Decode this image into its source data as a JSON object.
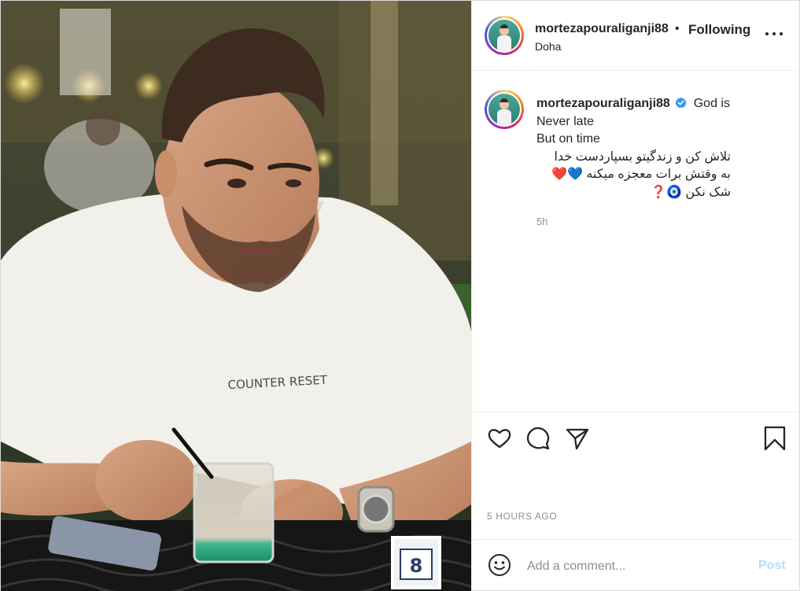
{
  "header": {
    "username": "mortezapouraliganji88",
    "separator": "•",
    "follow_status": "Following",
    "location": "Doha",
    "more_icon": "more-options-icon"
  },
  "caption": {
    "username": "mortezapouraliganji88",
    "verified_icon": "verified-badge-icon",
    "lines": [
      "God is",
      "Never late",
      "But on time",
      "تلاش کن و زندگیتو بسپاردست خدا",
      "به وقتش برات معجزه میکنه 💙❤️",
      "شک نکن 🧿❓"
    ],
    "time": "5h"
  },
  "actions": {
    "like_icon": "heart-icon",
    "comment_icon": "comment-icon",
    "share_icon": "share-icon",
    "save_icon": "bookmark-icon"
  },
  "post_time": "5 HOURS AGO",
  "comment_box": {
    "emoji_icon": "smiley-icon",
    "placeholder": "Add a comment...",
    "post_label": "Post"
  },
  "photo": {
    "shirt_text": "COUNTER RESET",
    "table_number": "8"
  },
  "colors": {
    "text": "#262626",
    "secondary": "#8e8e8e",
    "border": "#efefef",
    "post_button_disabled": "#b2dffc",
    "verified": "#3897f0"
  }
}
